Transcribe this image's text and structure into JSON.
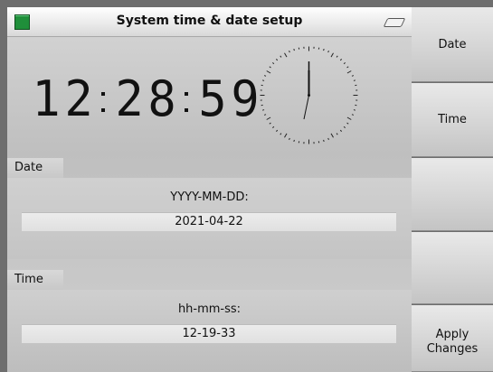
{
  "window": {
    "title": "System time & date setup"
  },
  "clock": {
    "hour_tens": "1",
    "hour_ones": "2",
    "minute_tens": "2",
    "minute_ones": "8",
    "second_tens": "5",
    "second_ones": "9"
  },
  "date_section": {
    "label": "Date",
    "format": "YYYY-MM-DD:",
    "value": "2021-04-22"
  },
  "time_section": {
    "label": "Time",
    "format": "hh-mm-ss:",
    "value": "12-19-33"
  },
  "softkeys": {
    "key1": "Date",
    "key2": "Time",
    "key3": "",
    "key4": "",
    "key5": "Apply\nChanges"
  },
  "colors": {
    "status_led": "#1f8f3a"
  }
}
